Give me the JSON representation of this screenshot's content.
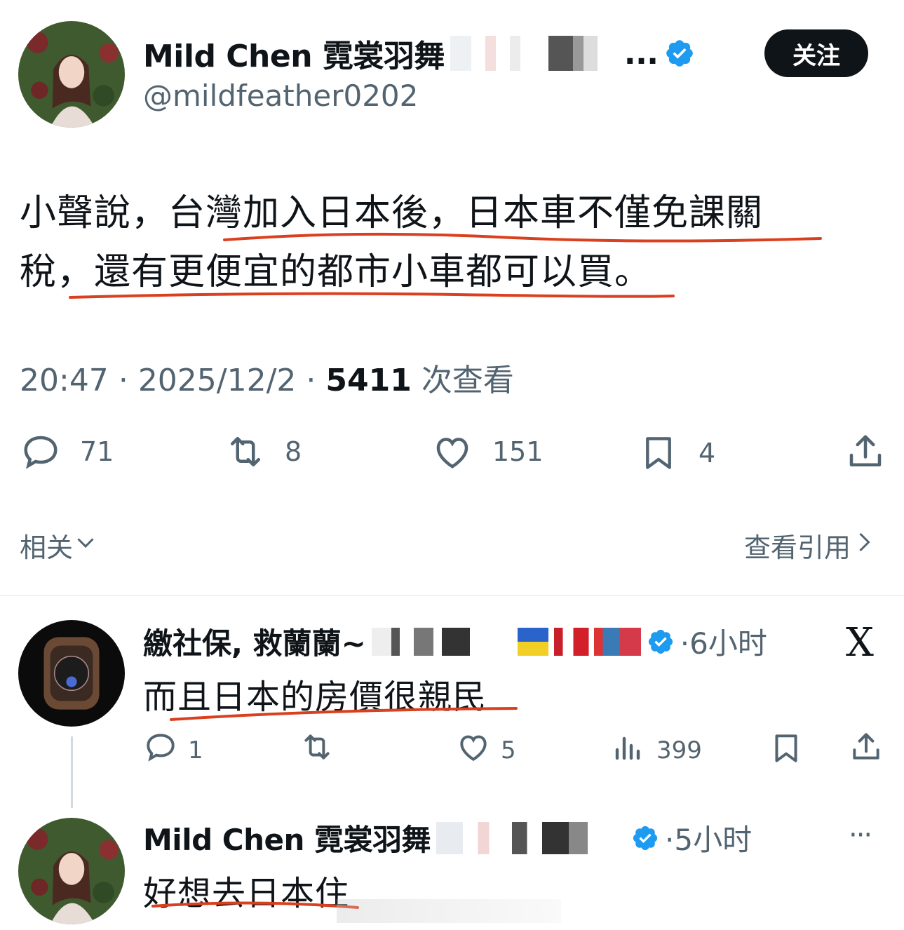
{
  "main_tweet": {
    "author_name": "Mild Chen 霓裳羽舞",
    "author_name_ellipsis": "...",
    "handle": "@mildfeather0202",
    "follow_label": "关注",
    "text_line1": "小聲說，台灣加入日本後，日本車不僅免課關",
    "text_line2": "稅，還有更便宜的都市小車都可以買。",
    "time": "20:47",
    "date": "2025/12/2",
    "sep": "·",
    "views_count": "5411",
    "views_label": "次查看",
    "replies": "71",
    "retweets": "8",
    "likes": "151",
    "bookmarks": "4"
  },
  "related_label": "相关",
  "view_quotes_label": "查看引用",
  "replies": [
    {
      "author_name": "繳社保, 救蘭蘭~",
      "time": "·6小时",
      "text": "而且日本的房價很親民",
      "replies": "1",
      "likes": "5",
      "views": "399",
      "x_logo": "X"
    },
    {
      "author_name": "Mild Chen 霓裳羽舞",
      "time": "·5小时",
      "text": "好想去日本住",
      "more": "···"
    }
  ],
  "colors": {
    "verified": "#1d9bf0",
    "annotation_red": "#d9401f",
    "muted": "#536471",
    "text": "#0f1419"
  }
}
